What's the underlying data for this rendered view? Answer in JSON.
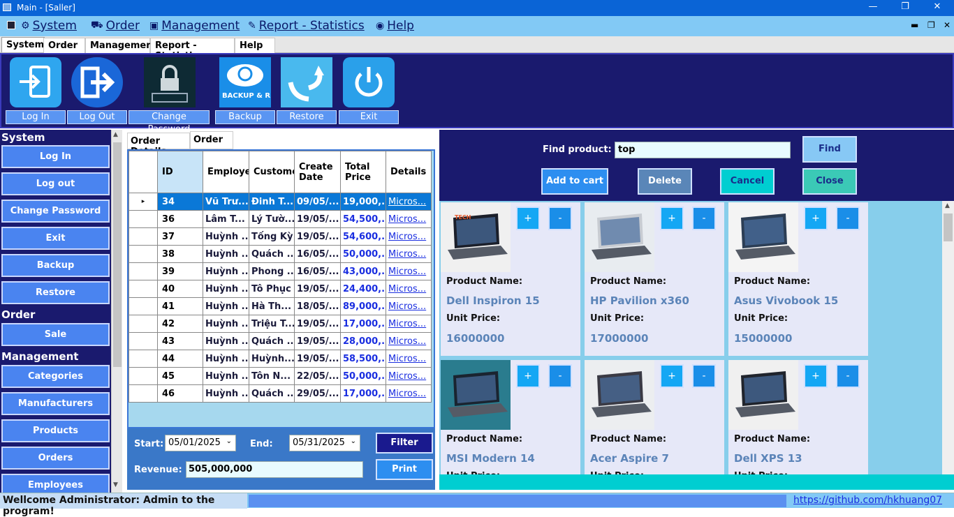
{
  "window": {
    "title": "Main - [Saller]"
  },
  "menu": {
    "items": [
      {
        "label": "System",
        "icon": "gears-icon"
      },
      {
        "label": "Order",
        "icon": "truck-icon"
      },
      {
        "label": "Management",
        "icon": "box-icon"
      },
      {
        "label": "Report - Statistics",
        "icon": "edit-icon"
      },
      {
        "label": "Help",
        "icon": "globe-icon"
      }
    ]
  },
  "ribbon_tabs": [
    "System",
    "Order",
    "Management",
    "Report - Statistics",
    "Help"
  ],
  "ribbon_buttons": [
    {
      "label": "Log In",
      "icon": "login-icon"
    },
    {
      "label": "Log Out",
      "icon": "logout-icon"
    },
    {
      "label": "Change Password",
      "icon": "password-lock-icon"
    },
    {
      "label": "Backup",
      "icon": "backup-restore-cloud-icon",
      "icon_text": "BACKUP & RESTORE"
    },
    {
      "label": "Restore",
      "icon": "restore-arrows-icon"
    },
    {
      "label": "Exit",
      "icon": "power-icon"
    }
  ],
  "sidebar": {
    "sections": [
      {
        "title": "System",
        "items": [
          "Log In",
          "Log out",
          "Change Password",
          "Exit",
          "Backup",
          "Restore"
        ]
      },
      {
        "title": "Order",
        "items": [
          "Sale"
        ]
      },
      {
        "title": "Management",
        "items": [
          "Categories",
          "Manufacturers",
          "Products",
          "Orders",
          "Employees"
        ]
      }
    ]
  },
  "order_panel": {
    "tabs": [
      "Order Details",
      "Order"
    ],
    "columns": [
      "ID",
      "Employee",
      "Customer",
      "Create Date",
      "Total Price",
      "Details"
    ],
    "rows": [
      {
        "id": "34",
        "employee": "Vũ Trư...",
        "customer": "Đinh T...",
        "date": "09/05/...",
        "total": "19,000,...",
        "details": "Micros..."
      },
      {
        "id": "36",
        "employee": "Lâm T...",
        "customer": "Lý Tườ...",
        "date": "19/05/...",
        "total": "54,500,...",
        "details": "Micros..."
      },
      {
        "id": "37",
        "employee": "Huỳnh ...",
        "customer": "Tống Kỳ",
        "date": "19/05/...",
        "total": "54,600,...",
        "details": "Micros..."
      },
      {
        "id": "38",
        "employee": "Huỳnh ...",
        "customer": "Quách ...",
        "date": "16/05/...",
        "total": "50,000,...",
        "details": "Micros..."
      },
      {
        "id": "39",
        "employee": "Huỳnh ...",
        "customer": "Phong ...",
        "date": "16/05/...",
        "total": "43,000,...",
        "details": "Micros..."
      },
      {
        "id": "40",
        "employee": "Huỳnh ...",
        "customer": "Tô Phục",
        "date": "19/05/...",
        "total": "24,400,...",
        "details": "Micros..."
      },
      {
        "id": "41",
        "employee": "Huỳnh ...",
        "customer": "Hà Th...",
        "date": "18/05/...",
        "total": "89,000,...",
        "details": "Micros..."
      },
      {
        "id": "42",
        "employee": "Huỳnh ...",
        "customer": "Triệu T...",
        "date": "19/05/...",
        "total": "17,000,...",
        "details": "Micros..."
      },
      {
        "id": "43",
        "employee": "Huỳnh ...",
        "customer": "Quách ...",
        "date": "19/05/...",
        "total": "28,000,...",
        "details": "Micros..."
      },
      {
        "id": "44",
        "employee": "Huỳnh ...",
        "customer": "Huỳnh...",
        "date": "19/05/...",
        "total": "58,500,...",
        "details": "Micros..."
      },
      {
        "id": "45",
        "employee": "Huỳnh ...",
        "customer": "Tôn N...",
        "date": "22/05/...",
        "total": "50,000,...",
        "details": "Micros..."
      },
      {
        "id": "46",
        "employee": "Huỳnh ...",
        "customer": "Quách ...",
        "date": "29/05/...",
        "total": "17,000,...",
        "details": "Micros..."
      }
    ],
    "selected_row_index": 0,
    "filter": {
      "start_label": "Start:",
      "start_value": "05/01/2025",
      "end_label": "End:",
      "end_value": "05/31/2025",
      "revenue_label": "Revenue:",
      "revenue_value": "505,000,000",
      "filter_button": "Filter",
      "print_button": "Print"
    }
  },
  "find_panel": {
    "label": "Find product:",
    "input_value": "top",
    "find_button": "Find",
    "add_button": "Add to cart",
    "delete_button": "Delete",
    "cancel_button": "Cancel",
    "close_button": "Close"
  },
  "products": {
    "name_label": "Product Name:",
    "price_label": "Unit Price:",
    "plus_label": "+",
    "minus_label": "-",
    "items": [
      {
        "name": "Dell Inspiron 15",
        "price": "16000000",
        "image_text": "TECH"
      },
      {
        "name": "HP Pavilion x360",
        "price": "17000000"
      },
      {
        "name": "Asus Vivobook 15",
        "price": "15000000"
      },
      {
        "name": "MSI Modern 14",
        "price": ""
      },
      {
        "name": "Acer Aspire 7",
        "price": ""
      },
      {
        "name": "Dell XPS 13",
        "price": ""
      }
    ]
  },
  "status": {
    "welcome": "Wellcome Administrator: Admin to the program!",
    "link": "https://github.com/hkhuang07"
  },
  "colors": {
    "navy": "#1a1a6e",
    "accent_blue": "#4a84f0",
    "cyan": "#00ced1",
    "sky": "#87ceeb",
    "selection": "#0a78d7"
  }
}
